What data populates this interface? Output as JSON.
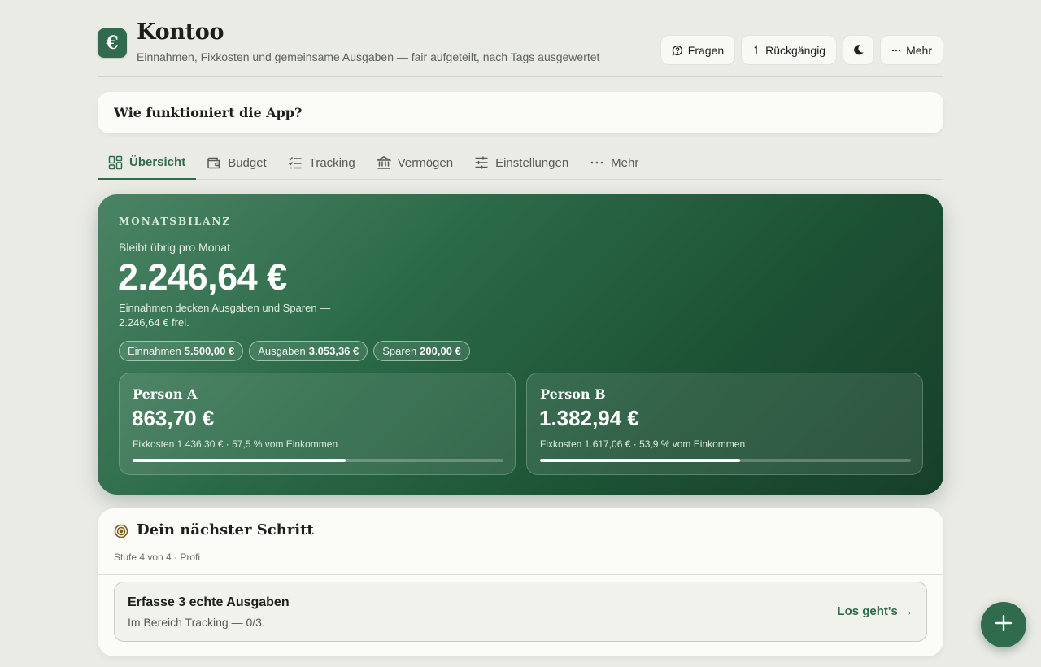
{
  "header": {
    "logo_glyph": "€",
    "title": "Kontoo",
    "subtitle": "Einnahmen, Fixkosten und gemeinsame Ausgaben — fair aufgeteilt, nach Tags ausgewertet",
    "actions": {
      "ask_label": "Fragen",
      "undo_label": "Rückgängig",
      "more_label": "Mehr"
    }
  },
  "help": {
    "question": "Wie funktioniert die App?"
  },
  "tabs": [
    {
      "label": "Übersicht",
      "icon": "dashboard-icon",
      "active": true
    },
    {
      "label": "Budget",
      "icon": "wallet-icon",
      "active": false
    },
    {
      "label": "Tracking",
      "icon": "checklist-icon",
      "active": false
    },
    {
      "label": "Vermögen",
      "icon": "bank-icon",
      "active": false
    },
    {
      "label": "Einstellungen",
      "icon": "sliders-icon",
      "active": false
    },
    {
      "label": "Mehr",
      "icon": "more-dots-icon",
      "active": false
    }
  ],
  "balance": {
    "kicker": "MONATSBILANZ",
    "label": "Bleibt übrig pro Monat",
    "value": "2.246,64 €",
    "description": "Einnahmen decken Ausgaben und Sparen — 2.246,64 € frei.",
    "pills": [
      {
        "label": "Einnahmen",
        "value": "5.500,00 €"
      },
      {
        "label": "Ausgaben",
        "value": "3.053,36 €"
      },
      {
        "label": "Sparen",
        "value": "200,00 €"
      }
    ],
    "persons": [
      {
        "name": "Person A",
        "value": "863,70 €",
        "meta": "Fixkosten 1.436,30 € · 57,5 % vom Einkommen",
        "progress": 0.575
      },
      {
        "name": "Person B",
        "value": "1.382,94 €",
        "meta": "Fixkosten 1.617,06 € · 53,9 % vom Einkommen",
        "progress": 0.539
      }
    ]
  },
  "next_step": {
    "title": "Dein nächster Schritt",
    "level": "Stufe 4 von 4 · Profi",
    "task": {
      "title": "Erfasse 3 echte Ausgaben",
      "subtitle": "Im Bereich Tracking — 0/3.",
      "action": "Los geht's →"
    }
  },
  "colors": {
    "accent": "#2f6b4c",
    "background": "#ebebe6",
    "card": "#fbfbf8"
  }
}
